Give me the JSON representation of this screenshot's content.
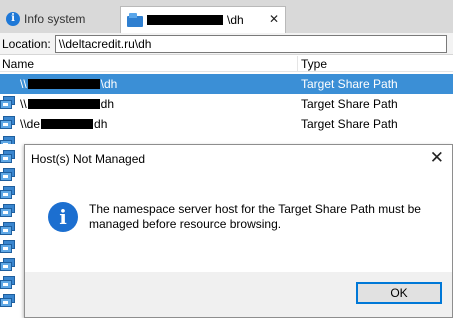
{
  "tabs": [
    {
      "label": "Info system",
      "icon": "info-icon"
    },
    {
      "label_suffix": "\\dh",
      "icon": "namespace-folder-icon",
      "close_glyph": "✕"
    }
  ],
  "location": {
    "label": "Location:",
    "value": "\\\\deltacredit.ru\\dh"
  },
  "columns": {
    "name": "Name",
    "type": "Type"
  },
  "rows": [
    {
      "name_prefix": "\\\\",
      "name_suffix": "\\dh",
      "type": "Target Share Path",
      "selected": true
    },
    {
      "name_prefix": "\\\\",
      "name_suffix": "dh",
      "type": "Target Share Path",
      "selected": false
    },
    {
      "name_prefix": "\\\\de",
      "name_suffix": "dh",
      "type": "Target Share Path",
      "selected": false
    }
  ],
  "dialog": {
    "title": "Host(s) Not Managed",
    "close_glyph": "✕",
    "icon": "information-icon",
    "message": "The namespace server host for the Target Share Path must be managed before resource browsing.",
    "ok_label": "OK"
  },
  "colors": {
    "selection": "#3b8fd6",
    "accent": "#0078d7",
    "info_icon": "#1c6fd0"
  }
}
